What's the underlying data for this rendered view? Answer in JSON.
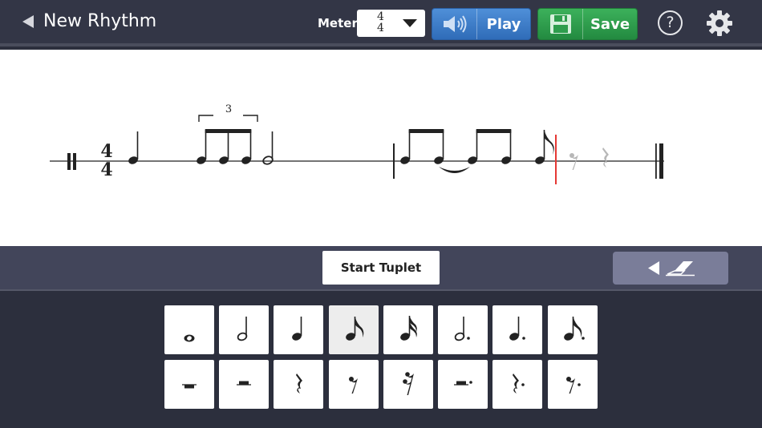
{
  "header": {
    "back_title": "New Rhythm",
    "meter_label": "Meter",
    "meter_value": {
      "numerator": "4",
      "denominator": "4"
    },
    "play_label": "Play",
    "save_label": "Save",
    "help_label": "?"
  },
  "score": {
    "time_signature": {
      "numerator": "4",
      "denominator": "4"
    },
    "tuplet_number": "3",
    "playhead_color": "#e53935"
  },
  "toolbar": {
    "start_tuplet_label": "Start Tuplet"
  },
  "palette": {
    "notes": [
      "whole-note-icon",
      "half-note-icon",
      "quarter-note-icon",
      "eighth-note-icon",
      "sixteenth-note-icon",
      "dotted-half-note-icon",
      "dotted-quarter-note-icon",
      "dotted-eighth-note-icon"
    ],
    "rests": [
      "whole-rest-icon",
      "half-rest-icon",
      "quarter-rest-icon",
      "eighth-rest-icon",
      "sixteenth-rest-icon",
      "dotted-half-rest-icon",
      "dotted-quarter-rest-icon",
      "dotted-eighth-rest-icon"
    ],
    "selected": "eighth-note-icon"
  },
  "colors": {
    "play_button": "#3b7cc9",
    "save_button": "#2e9d4d",
    "eraser_button": "#7a7d99"
  }
}
